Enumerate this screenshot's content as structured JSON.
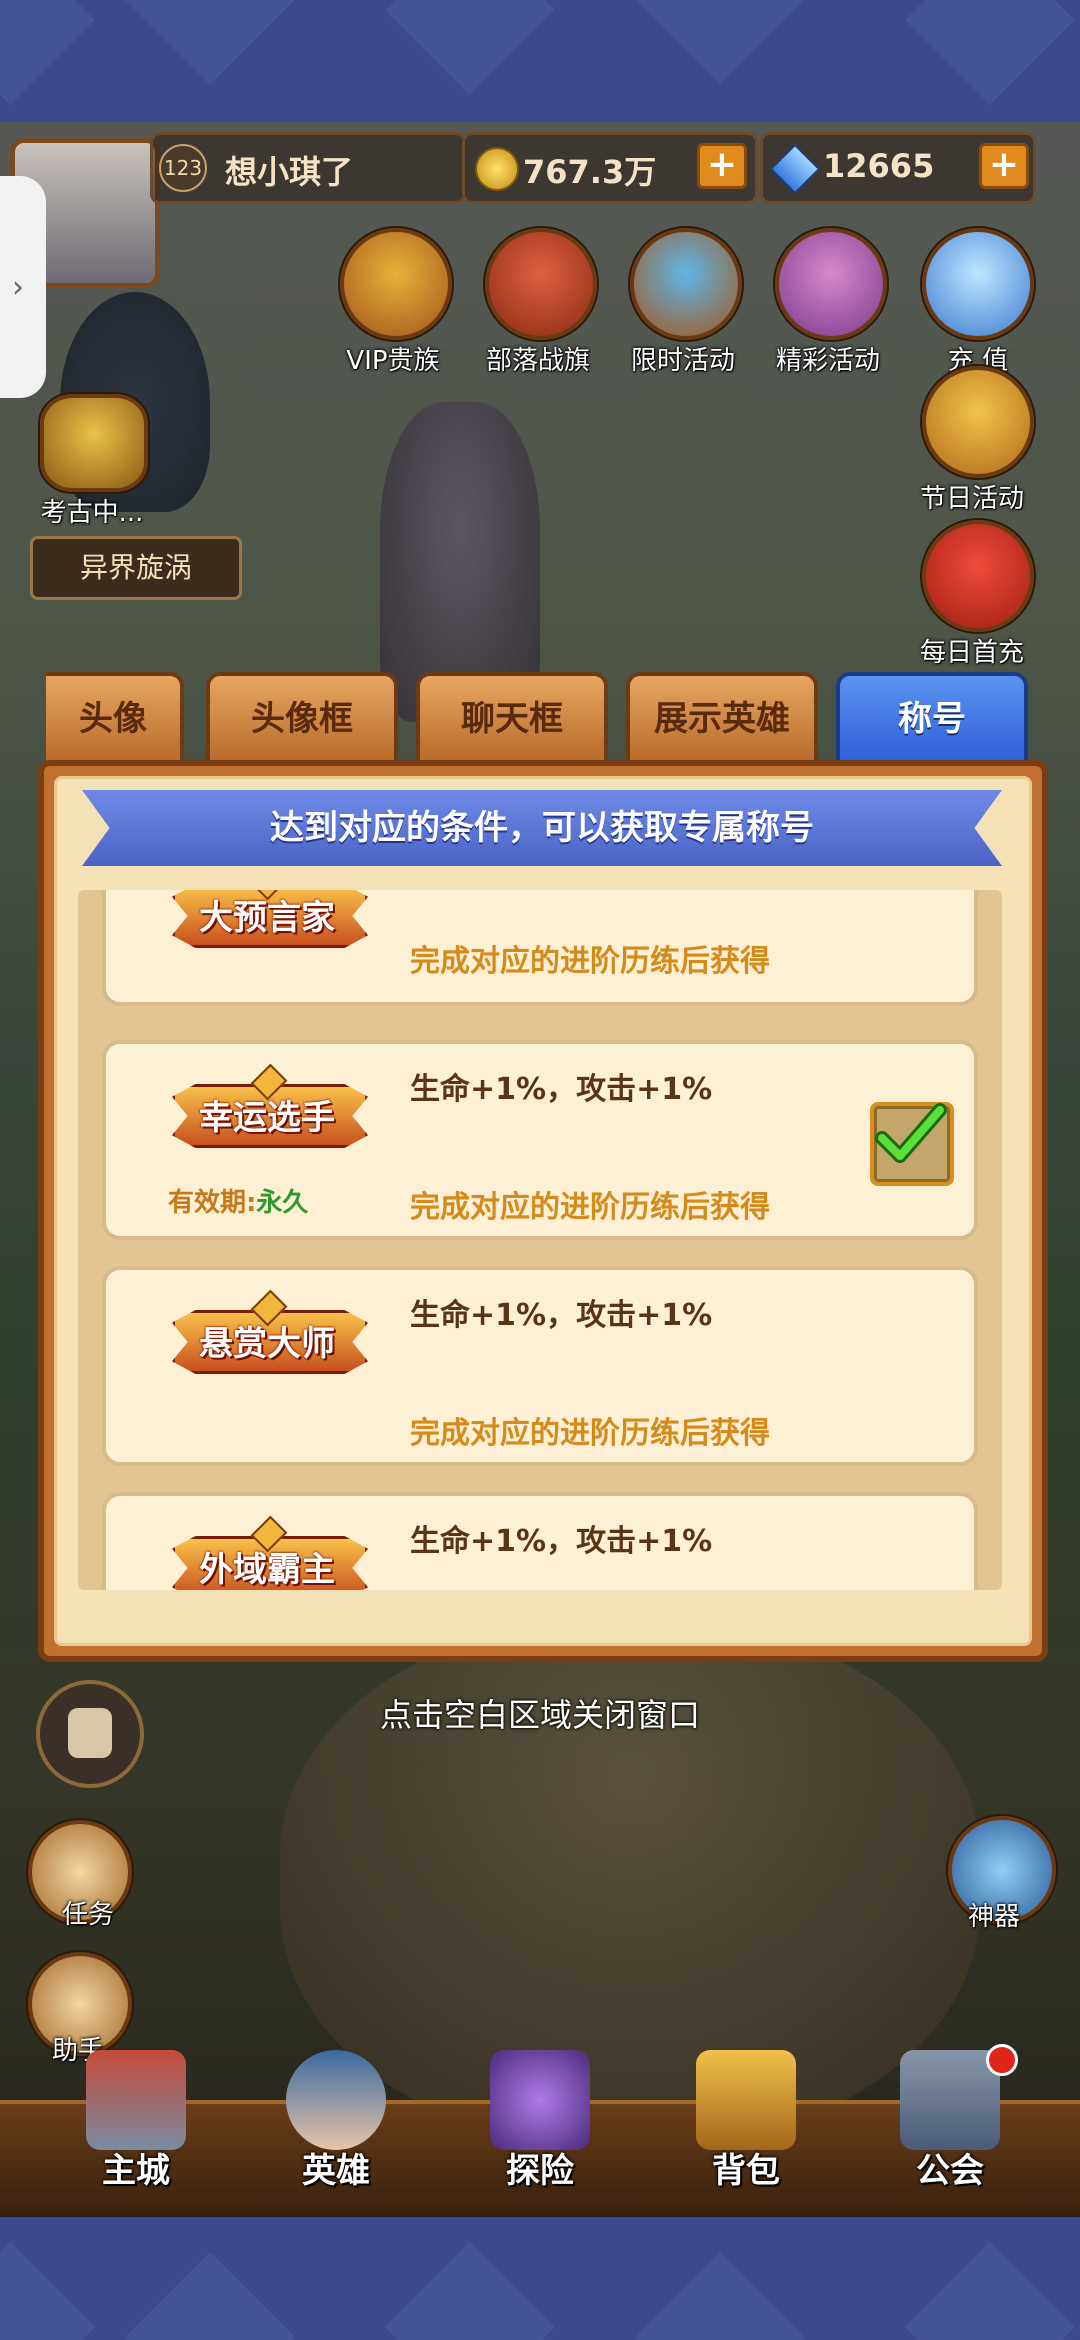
{
  "header": {
    "level": "123",
    "player_name": "想小琪了",
    "gold": "767.3万",
    "gems": "12665"
  },
  "right_icons": [
    {
      "label": "VIP贵族",
      "icon": "crown-icon"
    },
    {
      "label": "部落战旗",
      "icon": "war-flag-icon"
    },
    {
      "label": "限时活动",
      "icon": "compass-icon"
    },
    {
      "label": "精彩活动",
      "icon": "scroll-icon"
    },
    {
      "label": "充 值",
      "icon": "diamond-icon"
    }
  ],
  "side_icons": {
    "festival": "节日活动",
    "first_charge": "每日首充",
    "archaeology": "考古中...",
    "rift": "异界旋涡"
  },
  "tabs": [
    "头像",
    "头像框",
    "聊天框",
    "展示英雄",
    "称号"
  ],
  "active_tab": "称号",
  "panel": {
    "ribbon": "达到对应的条件，可以获取专属称号",
    "cards": [
      {
        "badge": "大预言家",
        "attr": "",
        "cond": "完成对应的进阶历练后获得",
        "valid_label": "",
        "valid_value": "",
        "selected": false
      },
      {
        "badge": "幸运选手",
        "attr": "生命+1%，攻击+1%",
        "cond": "完成对应的进阶历练后获得",
        "valid_label": "有效期:",
        "valid_value": "永久",
        "selected": true
      },
      {
        "badge": "悬赏大师",
        "attr": "生命+1%，攻击+1%",
        "cond": "完成对应的进阶历练后获得",
        "valid_label": "",
        "valid_value": "",
        "selected": false
      },
      {
        "badge": "外域霸主",
        "attr": "生命+1%，攻击+1%",
        "cond": "",
        "valid_label": "",
        "valid_value": "",
        "selected": false
      }
    ]
  },
  "close_hint": "点击空白区域关闭窗口",
  "left_buttons": {
    "task": "任务",
    "helper": "助手"
  },
  "right_buttons": {
    "artifact": "神器"
  },
  "bottom_nav": [
    "主城",
    "英雄",
    "探险",
    "背包",
    "公会"
  ],
  "colors": {
    "active_tab": "#3a6fe0",
    "panel": "#f4e1b6",
    "cond_text": "#d58a1c",
    "valid_green": "#2e9a2a"
  }
}
